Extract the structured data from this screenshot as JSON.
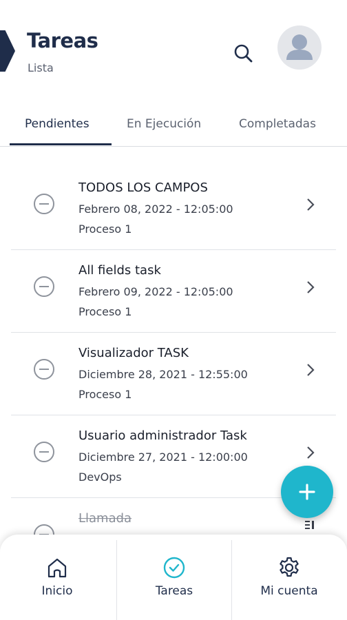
{
  "header": {
    "title": "Tareas",
    "subtitle": "Lista"
  },
  "tabs": [
    {
      "label": "Pendientes",
      "active": true
    },
    {
      "label": "En Ejecución",
      "active": false
    },
    {
      "label": "Completadas",
      "active": false
    }
  ],
  "tasks": [
    {
      "title": "TODOS LOS CAMPOS",
      "date": "Febrero 08, 2022 - 12:05:00",
      "process": "Proceso 1"
    },
    {
      "title": "All fields task",
      "date": "Febrero 09, 2022 - 12:05:00",
      "process": "Proceso 1"
    },
    {
      "title": "Visualizador TASK",
      "date": "Diciembre 28, 2021 - 12:55:00",
      "process": "Proceso 1"
    },
    {
      "title": "Usuario administrador Task",
      "date": "Diciembre 27, 2021 - 12:00:00",
      "process": "DevOps"
    },
    {
      "title": "Llamada",
      "date": "",
      "process": ""
    }
  ],
  "bottom_nav": [
    {
      "label": "Inicio",
      "icon": "home-icon"
    },
    {
      "label": "Tareas",
      "icon": "check-circle-icon"
    },
    {
      "label": "Mi cuenta",
      "icon": "gear-icon"
    }
  ],
  "fab": {
    "icon": "plus-icon"
  },
  "colors": {
    "primary": "#1f2d4a",
    "accent": "#1fb6cc"
  }
}
